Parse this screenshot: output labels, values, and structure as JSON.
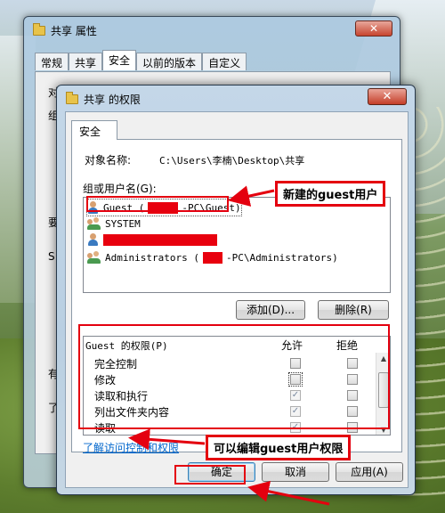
{
  "back_window": {
    "title": "共享 属性",
    "tabs": [
      "常规",
      "共享",
      "安全",
      "以前的版本",
      "自定义"
    ],
    "active_tab": 2,
    "partial_labels": [
      "对象名称:",
      "组",
      "要",
      "S",
      "有",
      "了"
    ]
  },
  "dialog": {
    "title": "共享 的权限",
    "close_label": "X",
    "tab": "安全",
    "object_label": "对象名称:",
    "object_path": "C:\\Users\\李楠\\Desktop\\共享",
    "groups_label": "组或用户名(G):",
    "users": [
      {
        "pre": "Guest (",
        "post": "-PC\\Guest)",
        "icon": "user-icon",
        "selected": true
      },
      {
        "pre": "SYSTEM",
        "post": "",
        "icon": "group-icon",
        "selected": false
      },
      {
        "pre": "",
        "post": "",
        "icon": "user-icon",
        "selected": false
      },
      {
        "pre": "Administrators (",
        "post": "-PC\\Administrators)",
        "icon": "group-icon",
        "selected": false
      }
    ],
    "add_button": "添加(D)...",
    "remove_button": "删除(R)",
    "perm_label": "Guest 的权限(P)",
    "allow_header": "允许",
    "deny_header": "拒绝",
    "permissions": [
      {
        "name": "完全控制",
        "allow": false,
        "deny": false
      },
      {
        "name": "修改",
        "allow": false,
        "deny": false
      },
      {
        "name": "读取和执行",
        "allow": true,
        "deny": false
      },
      {
        "name": "列出文件夹内容",
        "allow": true,
        "deny": false
      },
      {
        "name": "读取",
        "allow": true,
        "deny": false
      }
    ],
    "help_link": "了解访问控制和权限",
    "ok_button": "确定",
    "cancel_button": "取消",
    "apply_button": "应用(A)"
  },
  "annotations": {
    "new_guest": "新建的guest用户",
    "edit_perms": "可以编辑guest用户权限"
  },
  "colors": {
    "annotation_red": "#e4000f",
    "link_blue": "#0066cc"
  }
}
